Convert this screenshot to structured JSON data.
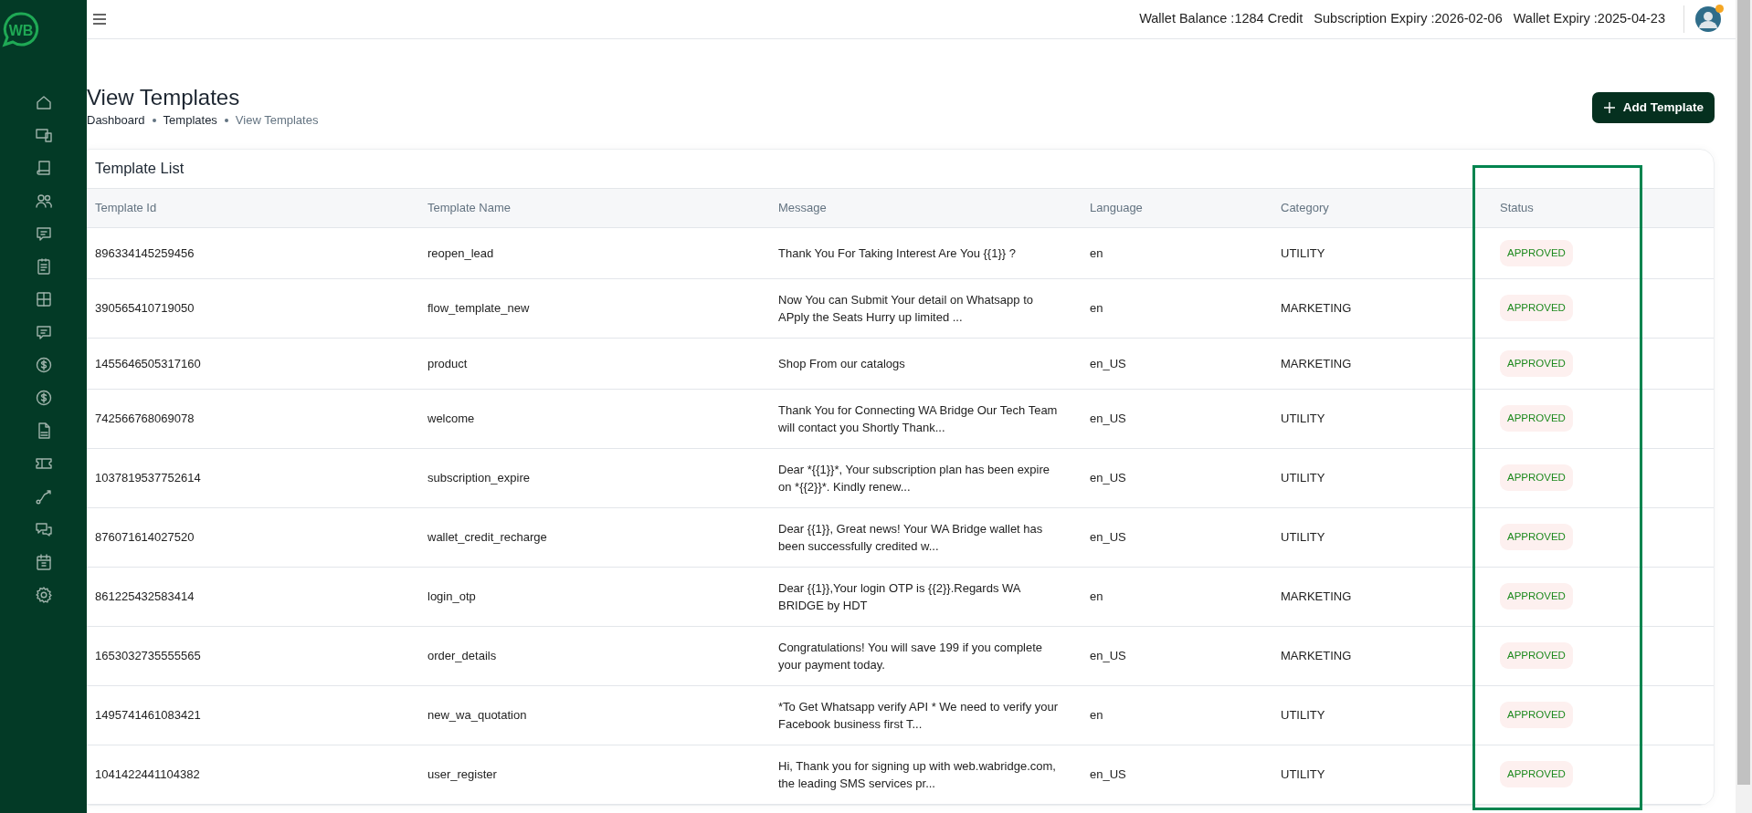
{
  "brand": {
    "logo_text": "WB"
  },
  "topbar": {
    "stats": [
      "Wallet Balance :1284 Credit",
      "Subscription Expiry :2026-02-06",
      "Wallet Expiry :2025-04-23"
    ]
  },
  "page": {
    "title": "View Templates",
    "breadcrumb": [
      {
        "label": "Dashboard",
        "active": false
      },
      {
        "label": "Templates",
        "active": false
      },
      {
        "label": "View Templates",
        "active": true
      }
    ],
    "add_button": "Add Template"
  },
  "card": {
    "title": "Template List"
  },
  "table": {
    "columns": [
      "Template Id",
      "Template Name",
      "Message",
      "Language",
      "Category",
      "Status"
    ],
    "rows": [
      {
        "id": "896334145259456",
        "name": "reopen_lead",
        "message": "Thank You For Taking Interest Are You {{1}} ?",
        "language": "en",
        "category": "UTILITY",
        "status": "APPROVED"
      },
      {
        "id": "390565410719050",
        "name": "flow_template_new",
        "message": "Now You can Submit Your detail on Whatsapp to APply the Seats Hurry up limited ...",
        "language": "en",
        "category": "MARKETING",
        "status": "APPROVED"
      },
      {
        "id": "1455646505317160",
        "name": "product",
        "message": "Shop From our catalogs",
        "language": "en_US",
        "category": "MARKETING",
        "status": "APPROVED"
      },
      {
        "id": "742566768069078",
        "name": "welcome",
        "message": "Thank You for Connecting WA Bridge Our Tech Team will contact you Shortly Thank...",
        "language": "en_US",
        "category": "UTILITY",
        "status": "APPROVED"
      },
      {
        "id": "1037819537752614",
        "name": "subscription_expire",
        "message": "Dear *{{1}}*, Your subscription plan has been expire on *{{2}}*. Kindly renew...",
        "language": "en_US",
        "category": "UTILITY",
        "status": "APPROVED"
      },
      {
        "id": "876071614027520",
        "name": "wallet_credit_recharge",
        "message": "Dear {{1}}, Great news! Your WA Bridge wallet has been successfully credited w...",
        "language": "en_US",
        "category": "UTILITY",
        "status": "APPROVED"
      },
      {
        "id": "861225432583414",
        "name": "login_otp",
        "message": "Dear {{1}},Your login OTP is {{2}}.Regards WA BRIDGE by HDT",
        "language": "en",
        "category": "MARKETING",
        "status": "APPROVED"
      },
      {
        "id": "1653032735555565",
        "name": "order_details",
        "message": "Congratulations! You will save 199 if you complete your payment today.",
        "language": "en_US",
        "category": "MARKETING",
        "status": "APPROVED"
      },
      {
        "id": "1495741461083421",
        "name": "new_wa_quotation",
        "message": "*To Get Whatsapp verify API * We need to verify your Facebook business first T...",
        "language": "en",
        "category": "UTILITY",
        "status": "APPROVED"
      },
      {
        "id": "1041422441104382",
        "name": "user_register",
        "message": "Hi, Thank you for signing up with web.wabridge.com, the leading SMS services pr...",
        "language": "en_US",
        "category": "UTILITY",
        "status": "APPROVED"
      }
    ]
  }
}
